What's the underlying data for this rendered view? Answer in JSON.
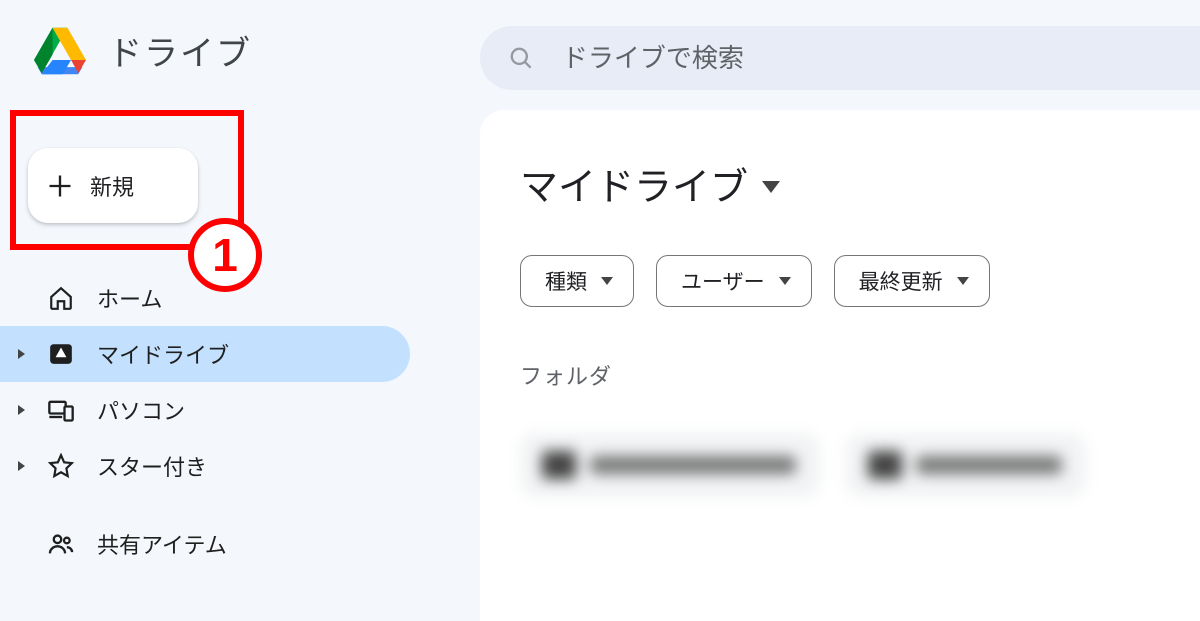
{
  "brand": {
    "title": "ドライブ"
  },
  "search": {
    "placeholder": "ドライブで検索"
  },
  "sidebar": {
    "new_label": "新規",
    "items": [
      {
        "label": "ホーム"
      },
      {
        "label": "マイドライブ"
      },
      {
        "label": "パソコン"
      },
      {
        "label": "スター付き"
      },
      {
        "label": "共有アイテム"
      }
    ],
    "annotation_number": "1"
  },
  "main": {
    "breadcrumb": "マイドライブ",
    "filters": [
      {
        "label": "種類"
      },
      {
        "label": "ユーザー"
      },
      {
        "label": "最終更新"
      }
    ],
    "folders_heading": "フォルダ"
  }
}
